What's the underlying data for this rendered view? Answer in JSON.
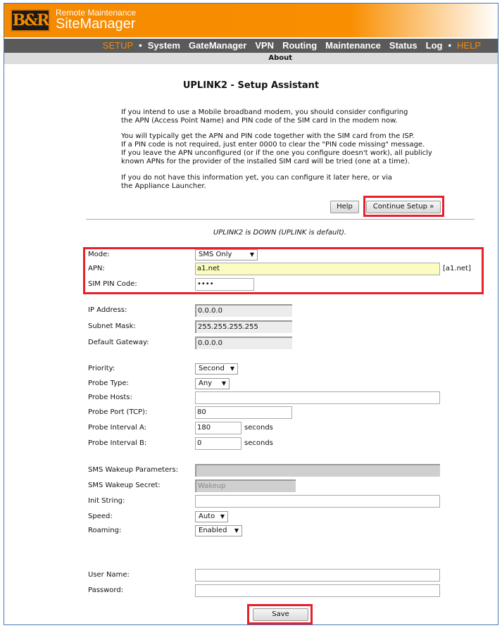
{
  "brand": {
    "logo": "B&R",
    "line1": "Remote Maintenance",
    "line2": "SiteManager"
  },
  "nav": {
    "items": [
      {
        "label": "SETUP",
        "active": true
      },
      {
        "label": "•"
      },
      {
        "label": "System"
      },
      {
        "label": "GateManager"
      },
      {
        "label": "VPN"
      },
      {
        "label": "Routing"
      },
      {
        "label": "Maintenance"
      },
      {
        "label": "Status"
      },
      {
        "label": "Log"
      },
      {
        "label": "•"
      },
      {
        "label": "HELP",
        "active": true
      }
    ],
    "sub": "About"
  },
  "title": "UPLINK2 - Setup Assistant",
  "intro": [
    "If you intend to use a Mobile broadband modem, you should consider configuring\nthe APN (Access Point Name) and PIN code of the SIM card in the modem now.",
    "You will typically get the APN and PIN code together with the SIM card from the ISP.\nIf a PIN code is not required, just enter 0000 to clear the \"PIN code missing\" message.\nIf you leave the APN unconfigured (or if the one you configure doesn't work), all publicly\nknown APNs for the provider of the installed SIM card will be tried (one at a time).",
    "If you do not have this information yet, you can configure it later here, or via\nthe Appliance Launcher."
  ],
  "buttons": {
    "help": "Help",
    "continue": "Continue Setup »",
    "save": "Save"
  },
  "status": "UPLINK2 is DOWN (UPLINK is default).",
  "highlight_color": "#e8202a",
  "fields": [
    {
      "label": "Mode:",
      "type": "select",
      "value": "SMS Only"
    },
    {
      "label": "APN:",
      "type": "text",
      "value": "a1.net",
      "style": "yel",
      "suffix": "[a1.net]"
    },
    {
      "label": "SIM PIN Code:",
      "type": "password",
      "value": "••••"
    },
    {
      "label": "IP Address:",
      "type": "text",
      "value": "0.0.0.0",
      "style": "ro"
    },
    {
      "label": "Subnet Mask:",
      "type": "text",
      "value": "255.255.255.255",
      "style": "ro"
    },
    {
      "label": "Default Gateway:",
      "type": "text",
      "value": "0.0.0.0",
      "style": "ro"
    },
    {
      "label": "Priority:",
      "type": "select",
      "value": "Second"
    },
    {
      "label": "Probe Type:",
      "type": "select",
      "value": "Any"
    },
    {
      "label": "Probe Hosts:",
      "type": "text",
      "value": ""
    },
    {
      "label": "Probe Port (TCP):",
      "type": "text",
      "value": "80"
    },
    {
      "label": "Probe Interval A:",
      "type": "text",
      "value": "180",
      "suffix": "seconds"
    },
    {
      "label": "Probe Interval B:",
      "type": "text",
      "value": "0",
      "suffix": "seconds"
    },
    {
      "label": "SMS Wakeup Parameters:",
      "type": "text",
      "value": "",
      "style": "dis"
    },
    {
      "label": "SMS Wakeup Secret:",
      "type": "text",
      "value": "Wakeup",
      "style": "dis"
    },
    {
      "label": "Init String:",
      "type": "text",
      "value": ""
    },
    {
      "label": "Speed:",
      "type": "select",
      "value": "Auto"
    },
    {
      "label": "Roaming:",
      "type": "select",
      "value": "Enabled"
    },
    {
      "label": "User Name:",
      "type": "text",
      "value": ""
    },
    {
      "label": "Password:",
      "type": "password",
      "value": ""
    }
  ]
}
